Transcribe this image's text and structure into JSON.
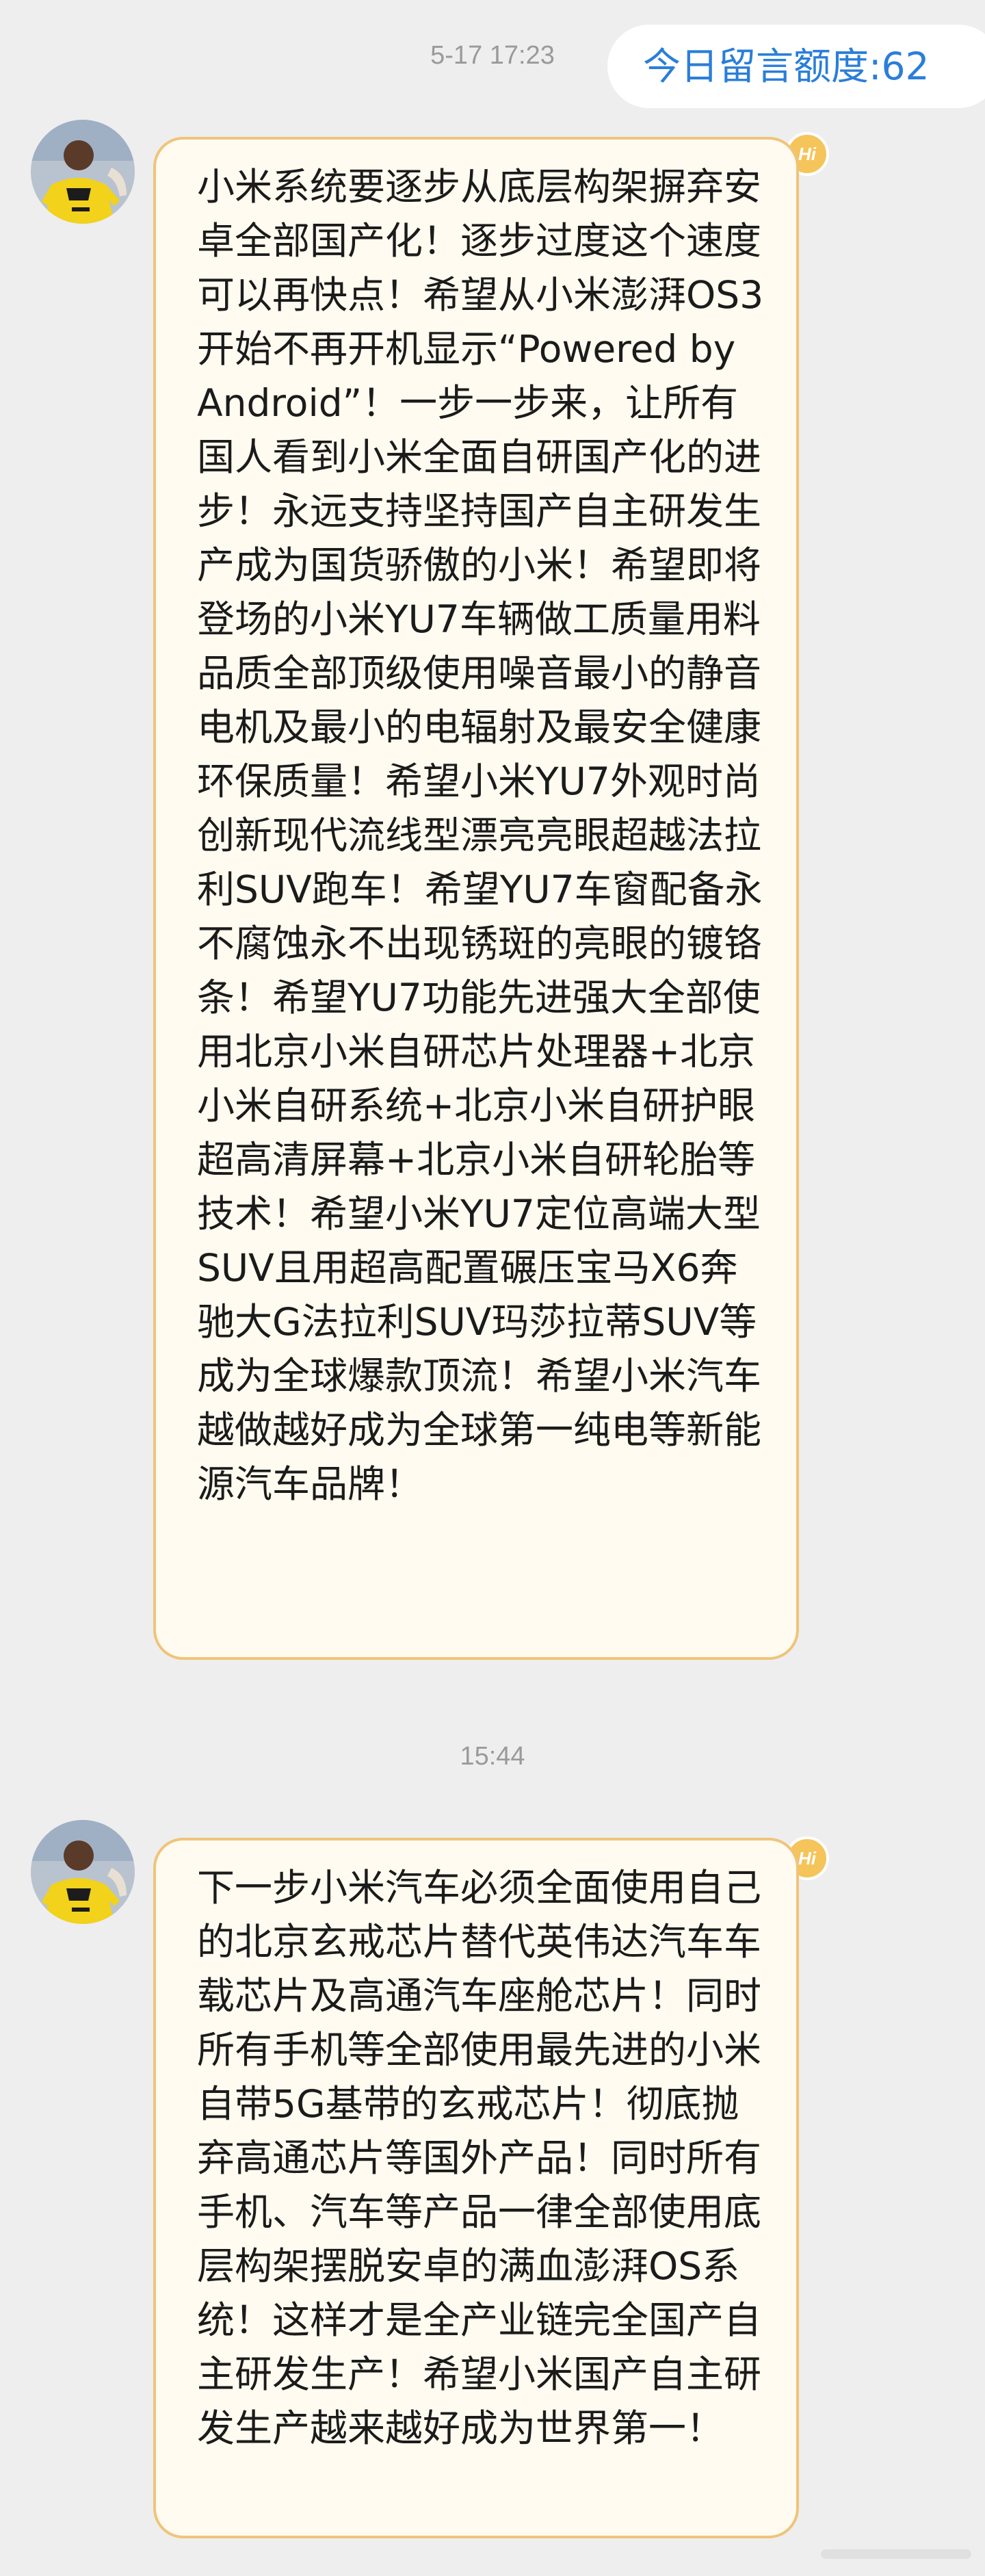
{
  "header": {
    "quota_label": "今日留言额度:62"
  },
  "conversation": [
    {
      "timestamp": "5-17 17:23",
      "badge": "Hi",
      "avatar_icon": "user-avatar-photo",
      "message": "小米系统要逐步从底层构架摒弃安卓全部国产化！逐步过度这个速度可以再快点！希望从小米澎湃OS3开始不再开机显示“Powered by Android”！一步一步来，让所有国人看到小米全面自研国产化的进步！永远支持坚持国产自主研发生产成为国货骄傲的小米！希望即将登场的小米YU7车辆做工质量用料品质全部顶级使用噪音最小的静音电机及最小的电辐射及最安全健康环保质量！希望小米YU7外观时尚创新现代流线型漂亮亮眼超越法拉利SUV跑车！希望YU7车窗配备永不腐蚀永不出现锈斑的亮眼的镀铬条！希望YU7功能先进强大全部使用北京小米自研芯片处理器+北京小米自研系统+北京小米自研护眼超高清屏幕+北京小米自研轮胎等技术！希望小米YU7定位高端大型SUV且用超高配置碾压宝马X6奔驰大G法拉利SUV玛莎拉蒂SUV等成为全球爆款顶流！希望小米汽车越做越好成为全球第一纯电等新能源汽车品牌！"
    },
    {
      "timestamp": "15:44",
      "badge": "Hi",
      "avatar_icon": "user-avatar-photo",
      "message": "下一步小米汽车必须全面使用自己的北京玄戒芯片替代英伟达汽车车载芯片及高通汽车座舱芯片！同时所有手机等全部使用最先进的小米自带5G基带的玄戒芯片！彻底抛弃高通芯片等国外产品！同时所有手机、汽车等产品一律全部使用底层构架摆脱安卓的满血澎湃OS系统！这样才是全产业链完全国产自主研发生产！希望小米国产自主研发生产越来越好成为世界第一！"
    }
  ],
  "colors": {
    "background": "#eeeeee",
    "bubble_fill": "#fffbf0",
    "bubble_border": "#efc47a",
    "quota_text": "#2a7ed8",
    "timestamp_text": "#9a9a9a",
    "badge_fill": "#f5c45a"
  }
}
